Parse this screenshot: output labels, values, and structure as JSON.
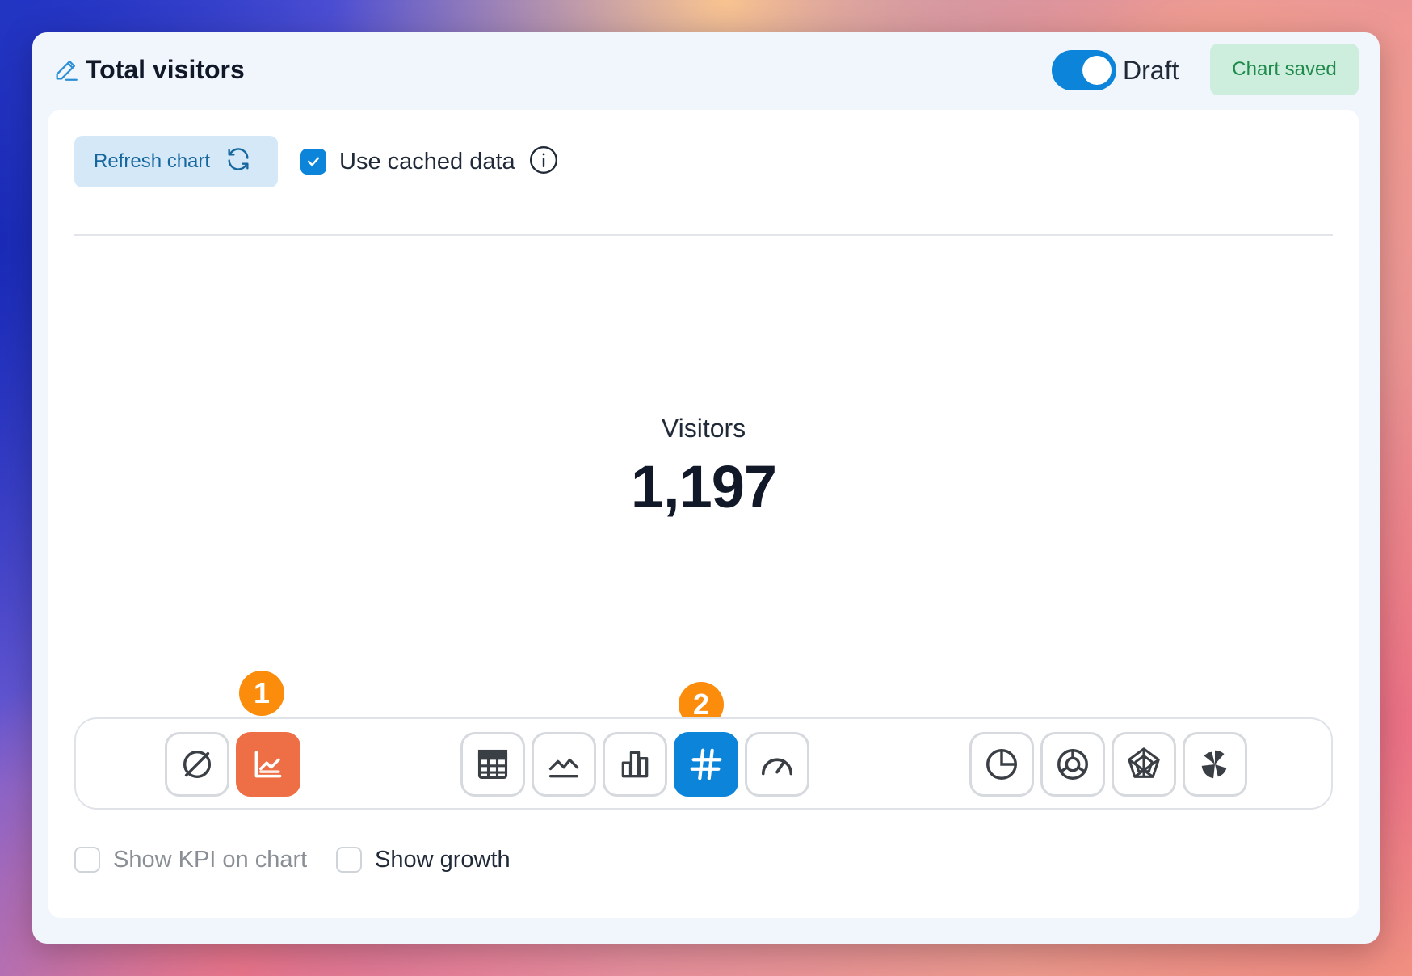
{
  "header": {
    "title": "Total visitors",
    "draft_label": "Draft",
    "draft_enabled": true,
    "saved_label": "Chart saved"
  },
  "toolbar_top": {
    "refresh_label": "Refresh chart",
    "cached_label": "Use cached data",
    "cached_checked": true
  },
  "kpi": {
    "label": "Visitors",
    "value": "1,197"
  },
  "badges": [
    "1",
    "2"
  ],
  "chart_types": [
    {
      "name": "no-chart",
      "icon": "slashed-circle-icon",
      "selected": false
    },
    {
      "name": "trend",
      "icon": "trend-chart-icon",
      "selected": true,
      "color": "#ee6f45"
    },
    {
      "name": "table",
      "icon": "table-icon",
      "selected": false
    },
    {
      "name": "line",
      "icon": "line-chart-icon",
      "selected": false
    },
    {
      "name": "bar",
      "icon": "bar-chart-icon",
      "selected": false
    },
    {
      "name": "number",
      "icon": "hash-icon",
      "selected": true,
      "color": "#0b84da"
    },
    {
      "name": "gauge",
      "icon": "gauge-icon",
      "selected": false
    },
    {
      "name": "pie",
      "icon": "pie-chart-icon",
      "selected": false
    },
    {
      "name": "donut",
      "icon": "donut-chart-icon",
      "selected": false
    },
    {
      "name": "radar",
      "icon": "radar-chart-icon",
      "selected": false
    },
    {
      "name": "rose",
      "icon": "rose-chart-icon",
      "selected": false
    }
  ],
  "options": {
    "show_kpi_label": "Show KPI on chart",
    "show_growth_label": "Show growth"
  },
  "colors": {
    "accent_blue": "#0b84da",
    "accent_orange": "#ee6f45",
    "badge_orange": "#fb8c0c",
    "saved_green": "#1f8a4c"
  }
}
